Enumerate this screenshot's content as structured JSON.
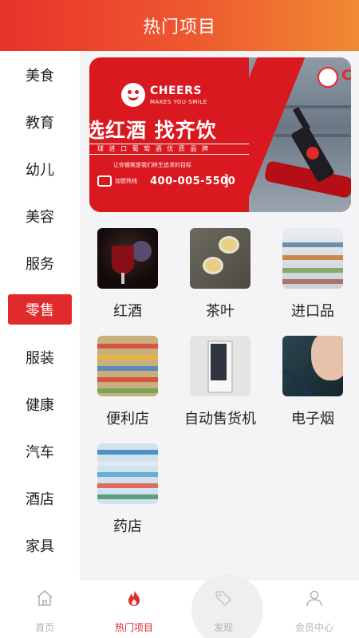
{
  "header": {
    "title": "热门项目"
  },
  "sidebar": {
    "items": [
      {
        "label": "美食"
      },
      {
        "label": "教育"
      },
      {
        "label": "幼儿"
      },
      {
        "label": "美容"
      },
      {
        "label": "服务"
      },
      {
        "label": "零售",
        "active": true
      },
      {
        "label": "服装"
      },
      {
        "label": "健康"
      },
      {
        "label": "汽车"
      },
      {
        "label": "酒店"
      },
      {
        "label": "家具"
      }
    ]
  },
  "banner": {
    "brand": "CHEERS",
    "brand_sub": "MAKES YOU SMILE",
    "headline": "选红酒 找齐饮",
    "line": "球 进 口 葡 萄 酒 优 质 品 牌",
    "slogan": "让你微笑是我们终生追求的目标",
    "phone_label": "加盟热线",
    "phone": "400-005-5500",
    "sign_text": "C"
  },
  "categories": [
    {
      "label": "红酒",
      "icon": "wine-glass-photo"
    },
    {
      "label": "茶叶",
      "icon": "tea-cups-photo"
    },
    {
      "label": "进口品",
      "icon": "import-store-photo"
    },
    {
      "label": "便利店",
      "icon": "convenience-store-photo"
    },
    {
      "label": "自动售货机",
      "icon": "vending-machine-photo"
    },
    {
      "label": "电子烟",
      "icon": "e-cigarette-photo"
    },
    {
      "label": "药店",
      "icon": "pharmacy-photo"
    }
  ],
  "tabbar": {
    "tabs": [
      {
        "label": "首页",
        "icon": "home-icon"
      },
      {
        "label": "热门项目",
        "icon": "flame-icon",
        "active": true
      },
      {
        "label": "发现",
        "icon": "tag-icon"
      },
      {
        "label": "会员中心",
        "icon": "user-icon"
      }
    ]
  },
  "colors": {
    "accent": "#e12a2b",
    "header_start": "#e8322b",
    "header_end": "#f08a33",
    "inactive_tab": "#b3b3b3"
  }
}
